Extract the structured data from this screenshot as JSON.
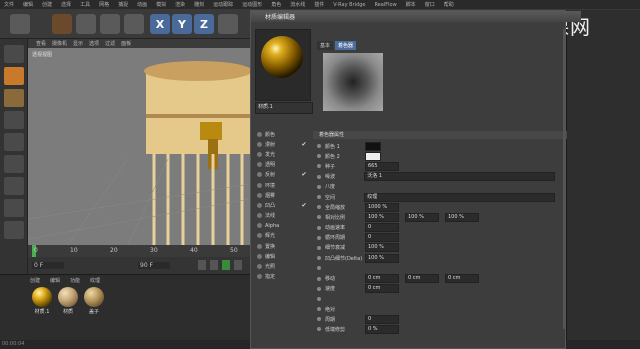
{
  "menubar": [
    "文件",
    "编辑",
    "创建",
    "选择",
    "工具",
    "网格",
    "捕捉",
    "动画",
    "模拟",
    "渲染",
    "雕刻",
    "运动跟踪",
    "运动图形",
    "角色",
    "流水线",
    "插件",
    "V-Ray Bridge",
    "RealFlow",
    "脚本",
    "窗口",
    "帮助"
  ],
  "toolbar": {
    "axes": [
      "X",
      "Y",
      "Z"
    ]
  },
  "viewport": {
    "menu": [
      "查看",
      "摄像机",
      "显示",
      "选项",
      "过滤",
      "面板"
    ],
    "label": "透视视图"
  },
  "timeline": {
    "ticks": [
      "0",
      "10",
      "20",
      "30",
      "40",
      "50"
    ],
    "start": "0 F",
    "end": "90 F"
  },
  "material_manager": {
    "menu": [
      "创建",
      "编辑",
      "功能",
      "纹理"
    ],
    "materials": [
      {
        "label": "材质.1",
        "color": "#e2ae1a"
      },
      {
        "label": "材质",
        "color": "#c8a878"
      },
      {
        "label": "盖子",
        "color": "#b89a60"
      }
    ]
  },
  "editor": {
    "title": "材质编辑器",
    "material_name": "材质.1",
    "tabs": [
      "基本",
      "着色器"
    ],
    "active_tab": "着色器",
    "channels": [
      {
        "name": "颜色",
        "checked": ""
      },
      {
        "name": "漫射",
        "checked": "✔"
      },
      {
        "name": "发光",
        "checked": ""
      },
      {
        "name": "透明",
        "checked": ""
      },
      {
        "name": "反射",
        "checked": "✔"
      },
      {
        "name": "环境",
        "checked": ""
      },
      {
        "name": "烟雾",
        "checked": ""
      },
      {
        "name": "凹凸",
        "checked": "✔"
      },
      {
        "name": "法线",
        "checked": ""
      },
      {
        "name": "Alpha",
        "checked": ""
      },
      {
        "name": "辉光",
        "checked": ""
      },
      {
        "name": "置换",
        "checked": ""
      },
      {
        "name": "编辑",
        "checked": ""
      },
      {
        "name": "光照",
        "checked": ""
      },
      {
        "name": "指定",
        "checked": ""
      }
    ],
    "section_title": "着色器属性",
    "props": [
      {
        "name": "颜色 1",
        "values": []
      },
      {
        "name": "颜色 2",
        "values": []
      },
      {
        "name": "种子",
        "values": [
          "665"
        ]
      },
      {
        "name": "噪波",
        "values": [
          "沃洛 1"
        ]
      },
      {
        "name": "八度",
        "values": []
      },
      {
        "name": "空间",
        "values": [
          "纹理"
        ]
      },
      {
        "name": "全局缩放",
        "values": [
          "1000 %"
        ]
      },
      {
        "name": "相对比例",
        "values": [
          "100 %",
          "100 %",
          "100 %"
        ]
      },
      {
        "name": "动画速率",
        "values": [
          "0"
        ]
      },
      {
        "name": "循环周期",
        "values": [
          "0"
        ]
      },
      {
        "name": "细节衰减",
        "values": [
          "100 %"
        ]
      },
      {
        "name": "凹凸细节(Delta)",
        "values": [
          "100 %"
        ]
      },
      {
        "name": "",
        "values": []
      },
      {
        "name": "移动",
        "values": [
          "0 cm",
          "0 cm",
          "0 cm"
        ]
      },
      {
        "name": "速度",
        "values": [
          "0 cm"
        ]
      },
      {
        "name": "",
        "values": []
      },
      {
        "name": "绝对",
        "values": []
      },
      {
        "name": "周期",
        "values": [
          "0"
        ]
      },
      {
        "name": "低端修剪",
        "values": [
          "0 %"
        ]
      }
    ]
  },
  "brand": {
    "mark": "虎",
    "text": "虎课网"
  },
  "status": {
    "time": "00:00:04"
  },
  "colors": {
    "accent": "#4d6d9d",
    "gold": "#e0b020"
  }
}
